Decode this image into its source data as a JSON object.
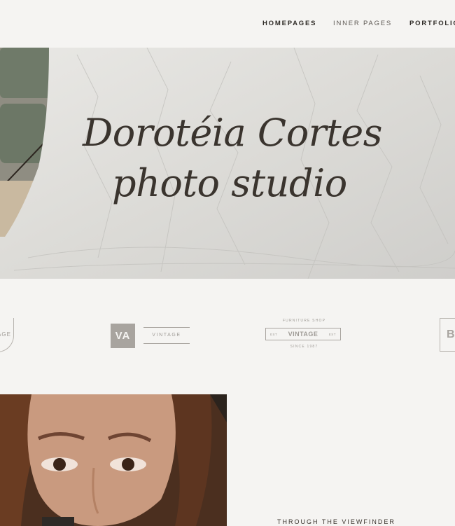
{
  "nav": {
    "items": [
      {
        "label": "HOMEPAGES"
      },
      {
        "label": "INNER PAGES"
      },
      {
        "label": "PORTFOLIO"
      }
    ]
  },
  "hero": {
    "title_line1": "Dorotéia Cortes",
    "title_line2": "photo studio"
  },
  "logos": {
    "a": {
      "text": "AGE"
    },
    "b": {
      "monogram": "VA",
      "word": "VINTAGE"
    },
    "c": {
      "top": "FURNITURE SHOP",
      "left": "EST",
      "word": "VINTAGE",
      "right": "EST",
      "bottom": "SINCE 1987"
    },
    "d": {
      "letter": "B"
    }
  },
  "feature": {
    "caption": "THROUGH THE VIEWFINDER"
  },
  "colors": {
    "background": "#f5f4f2",
    "text": "#2f2b27",
    "logo_gray": "#a8a49f"
  }
}
